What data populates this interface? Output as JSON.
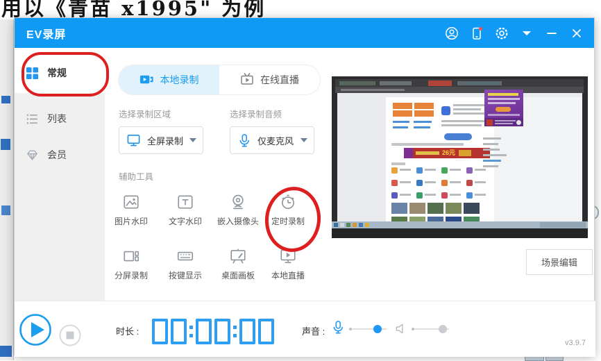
{
  "background": {
    "top_text": "用以《青苗 x1995\" 为例"
  },
  "window": {
    "title": "EV录屏",
    "titlebar_icons": [
      "account",
      "mobile-sync",
      "settings",
      "more-dropdown",
      "minimize",
      "close"
    ],
    "sidebar": {
      "items": [
        {
          "icon": "grid",
          "label": "常规",
          "active": true
        },
        {
          "icon": "list",
          "label": "列表",
          "active": false
        },
        {
          "icon": "vip-diamond",
          "label": "会员",
          "active": false
        }
      ]
    },
    "tabs": [
      {
        "icon": "camcorder",
        "label": "本地录制",
        "active": true
      },
      {
        "icon": "tv-live",
        "label": "在线直播",
        "active": false
      }
    ],
    "area_select": {
      "label": "选择录制区域",
      "icon": "monitor",
      "value": "全屏录制"
    },
    "audio_select": {
      "label": "选择录制音频",
      "icon": "microphone",
      "value": "仅麦克风"
    },
    "tools": {
      "title": "辅助工具",
      "items": [
        {
          "icon": "image-watermark",
          "label": "图片水印"
        },
        {
          "icon": "text-watermark",
          "label": "文字水印"
        },
        {
          "icon": "webcam",
          "label": "嵌入摄像头"
        },
        {
          "icon": "timer-record",
          "label": "定时录制",
          "annotated": true
        },
        {
          "icon": "split-screen",
          "label": "分屏录制"
        },
        {
          "icon": "key-display",
          "label": "按键显示"
        },
        {
          "icon": "desktop-board",
          "label": "桌面画板"
        },
        {
          "icon": "local-live",
          "label": "本地直播"
        }
      ]
    },
    "preview": {
      "banner_price": "26元"
    },
    "scene_edit": "场景编辑",
    "controls": {
      "duration_label": "时长 :",
      "time": "00:00:00",
      "sound_label": "声音 :",
      "mic_level": 0.76,
      "speaker_level": 0.84,
      "version": "v3.9.7"
    }
  }
}
